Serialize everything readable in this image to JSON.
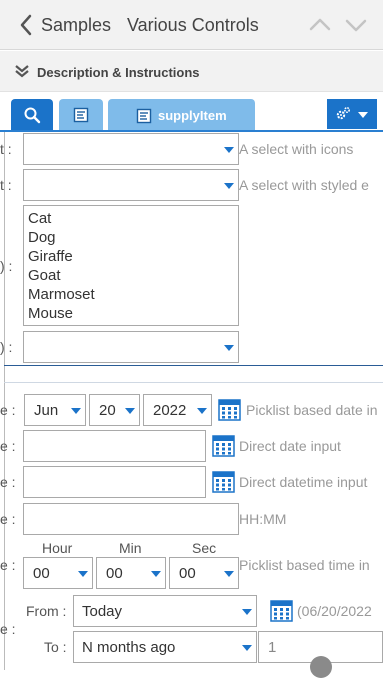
{
  "header": {
    "back_label": "Samples",
    "title": "Various Controls"
  },
  "description": {
    "label": "Description & Instructions"
  },
  "tabs": [
    {
      "label": ""
    },
    {
      "label": ""
    },
    {
      "label": "supplyItem"
    }
  ],
  "form": {
    "select1": {
      "label_frag": "t :",
      "value": "",
      "hint": "A select with icons"
    },
    "select2": {
      "label_frag": "t :",
      "value": "",
      "hint": "A select with styled e"
    },
    "listbox": {
      "label_frag": ") :",
      "items": [
        "Cat",
        "Dog",
        "Giraffe",
        "Goat",
        "Marmoset",
        "Mouse"
      ]
    },
    "select3": {
      "label_frag": ") :",
      "value": ""
    },
    "date_picklist": {
      "label_frag": "e :",
      "month": "Jun",
      "day": "20",
      "year": "2022",
      "hint": "Picklist based date in"
    },
    "date_direct": {
      "label_frag": "e :",
      "value": "",
      "hint": "Direct date input"
    },
    "datetime_direct": {
      "label_frag": "e :",
      "value": "",
      "hint": "Direct datetime input"
    },
    "time_direct": {
      "label_frag": "e :",
      "value": "",
      "hint": "HH:MM"
    },
    "time_picklist": {
      "label_frag": "e :",
      "hour_label": "Hour",
      "min_label": "Min",
      "sec_label": "Sec",
      "hour": "00",
      "min": "00",
      "sec": "00",
      "hint": "Picklist based time in"
    },
    "range": {
      "label_frag": "e :",
      "from_label": "From :",
      "from_value": "Today",
      "from_hint": "(06/20/2022",
      "to_label": "To :",
      "to_value": "N months ago",
      "to_amount": "1"
    }
  },
  "colors": {
    "accent": "#1b73c9",
    "tab_light": "#7fbbea",
    "header_bg": "#f2f2f2",
    "separator": "#2a5c96"
  }
}
